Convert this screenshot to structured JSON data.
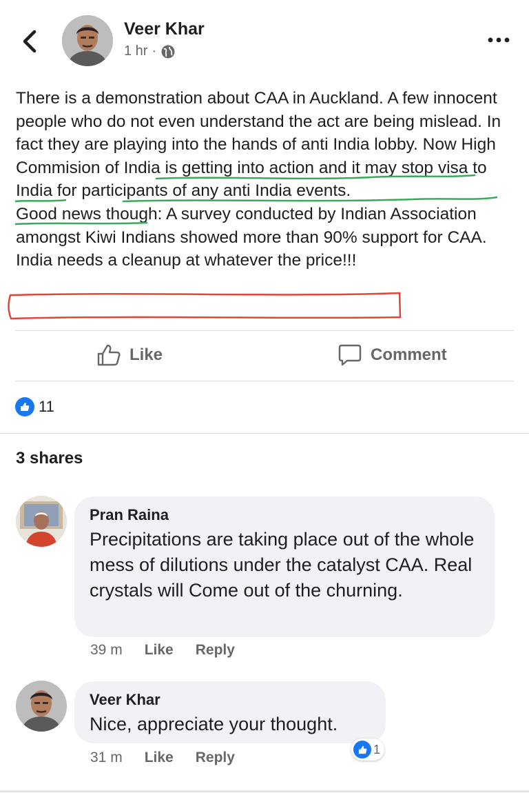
{
  "post": {
    "author": "Veer Khar",
    "time": "1 hr",
    "separator": "·",
    "text_1": "There is a demonstration  about CAA in Auckland.  A few innocent people who do not even understand the act are being mislead. In fact they are playing into the hands of anti India lobby. Now ",
    "text_hl1": "High Commision of India is getting into action",
    "text_2": " and it ",
    "text_hl2": "may stop visa to India for participants of any anti India events",
    "text_3": ".",
    "text_para2": "Good news though: A survey conducted by Indian Association amongst Kiwi Indians showed more than 90% support for CAA.",
    "text_para3": "India needs a cleanup at whatever the price!!!"
  },
  "actions": {
    "like": "Like",
    "comment": "Comment"
  },
  "reactions": {
    "count": "11"
  },
  "shares": "3 shares",
  "comments": [
    {
      "name": "Pran Raina",
      "text": "Precipitations are taking place out of the whole mess of dilutions under the catalyst CAA. Real crystals will Come out of the churning.",
      "time": "39 m",
      "like": "Like",
      "reply": "Reply"
    },
    {
      "name": "Veer Khar",
      "text": "Nice, appreciate your thought.",
      "time": "31 m",
      "like": "Like",
      "reply": "Reply",
      "reaction_count": "1"
    }
  ],
  "colors": {
    "accent": "#1877f2",
    "underline_green": "#3aaa5a",
    "highlight_red": "#e0453c",
    "secondary_text": "#65676b"
  },
  "icons": {
    "back": "chevron-left-icon",
    "globe": "globe-icon",
    "more": "more-dots-icon",
    "like": "thumbs-up-icon",
    "comment": "comment-bubble-icon"
  }
}
